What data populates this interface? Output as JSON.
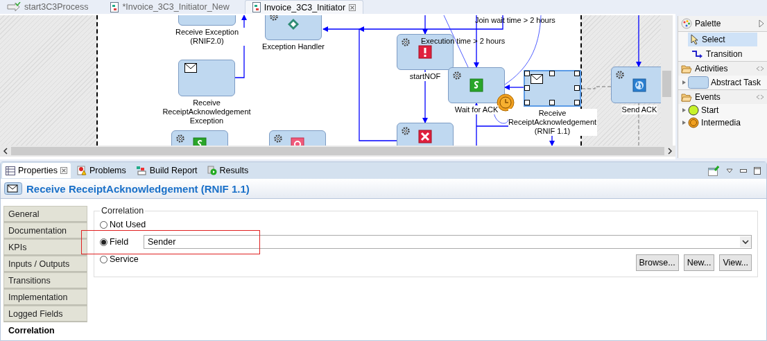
{
  "editor_tabs": [
    {
      "label": "start3C3Process",
      "kind": "process",
      "selected": false,
      "closable": false
    },
    {
      "label": "*Invoice_3C3_Initiator_New",
      "kind": "diagram",
      "selected": false,
      "closable": false
    },
    {
      "label": "Invoice_3C3_Initiator",
      "kind": "diagram",
      "selected": true,
      "closable": true
    }
  ],
  "diagram": {
    "nodes": [
      {
        "label": "Receive Exception (RNIF2.0)",
        "kind": "plain",
        "selected": false
      },
      {
        "label": "Exception Handler",
        "kind": "gateway",
        "selected": false
      },
      {
        "label": "Receive ReceiptAcknowledgementException",
        "kind": "receive",
        "selected": false
      },
      {
        "kind": "script",
        "selected": false
      },
      {
        "kind": "terminate",
        "selected": false
      },
      {
        "label": "startNOF",
        "kind": "alert",
        "selected": false
      },
      {
        "label": "Wait for ACK",
        "kind": "script",
        "selected": false,
        "timer": true
      },
      {
        "label": "Receive ReceiptAcknowledgement (RNIF 1.1)",
        "kind": "receive",
        "selected": true
      },
      {
        "label": "Send ACK",
        "kind": "web",
        "selected": false
      },
      {
        "kind": "cancel",
        "selected": false
      }
    ],
    "conditions": [
      "Join wait time > 2 hours",
      "Execution time > 2 hours"
    ]
  },
  "palette": {
    "title": "Palette",
    "tools": [
      {
        "label": "Select",
        "kind": "select",
        "selected": true
      },
      {
        "label": "Transition",
        "kind": "transition",
        "selected": false
      }
    ],
    "drawers": [
      {
        "label": "Activities",
        "items": [
          {
            "label": "Abstract Task",
            "kind": "task"
          }
        ]
      },
      {
        "label": "Events",
        "items": [
          {
            "label": "Start",
            "kind": "start"
          },
          {
            "label": "Intermedia",
            "kind": "intermediate"
          }
        ]
      }
    ]
  },
  "properties": {
    "tabs": [
      {
        "label": "Properties",
        "kind": "properties",
        "selected": true,
        "closable": true
      },
      {
        "label": "Problems",
        "kind": "problems",
        "selected": false,
        "closable": false
      },
      {
        "label": "Build Report",
        "kind": "build",
        "selected": false,
        "closable": false
      },
      {
        "label": "Results",
        "kind": "results",
        "selected": false,
        "closable": false
      }
    ],
    "title": "Receive ReceiptAcknowledgement (RNIF 1.1)",
    "sections": [
      {
        "label": "General",
        "selected": false
      },
      {
        "label": "Documentation",
        "selected": false
      },
      {
        "label": "KPIs",
        "selected": false
      },
      {
        "label": "Inputs / Outputs",
        "selected": false
      },
      {
        "label": "Transitions",
        "selected": false
      },
      {
        "label": "Implementation",
        "selected": false
      },
      {
        "label": "Logged Fields",
        "selected": false
      },
      {
        "label": "Correlation",
        "selected": true
      }
    ],
    "correlation": {
      "title": "Correlation",
      "options": [
        {
          "label": "Not Used",
          "selected": false
        },
        {
          "label": "Field",
          "selected": true
        },
        {
          "label": "Service",
          "selected": false
        }
      ],
      "field": {
        "value": "Sender"
      },
      "buttons": [
        "Browse...",
        "New...",
        "View..."
      ]
    }
  }
}
